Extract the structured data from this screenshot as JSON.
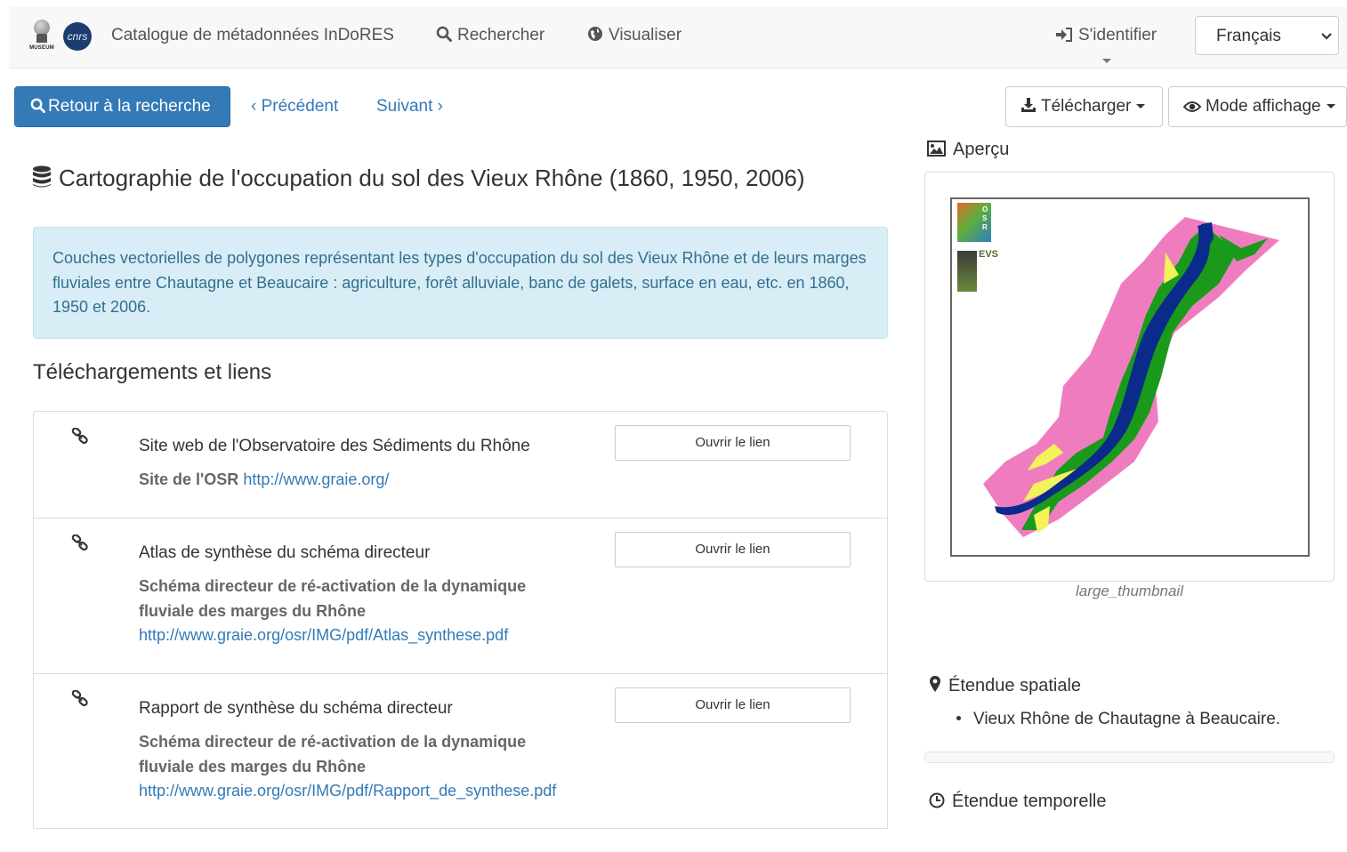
{
  "navbar": {
    "logo_museum_text": "MUSEUM",
    "logo_cnrs_text": "cnrs",
    "brand": "Catalogue de métadonnées InDoRES",
    "search": "Rechercher",
    "visualize": "Visualiser",
    "login": "S'identifier",
    "language": "Français"
  },
  "toolbar": {
    "back": "Retour à la recherche",
    "previous": "‹ Précédent",
    "next": "Suivant ›",
    "download": "Télécharger",
    "display_mode": "Mode affichage"
  },
  "record": {
    "title": "Cartographie de l'occupation du sol des Vieux Rhône (1860, 1950, 2006)",
    "abstract": "Couches vectorielles de polygones représentant les types d'occupation du sol des Vieux Rhône et de leurs marges fluviales entre Chautagne et Beaucaire : agriculture, forêt alluviale, banc de galets, surface en eau, etc. en 1860, 1950 et 2006."
  },
  "links_section": {
    "heading": "Téléchargements et liens",
    "items": [
      {
        "title": "Site web de l'Observatoire des Sédiments du Rhône",
        "desc_bold": "Site de l'OSR",
        "url": "http://www.graie.org/",
        "button": "Ouvrir le lien"
      },
      {
        "title": "Atlas de synthèse du schéma directeur",
        "desc_bold": "Schéma directeur de ré-activation de la dynamique fluviale des marges du Rhône",
        "url": "http://www.graie.org/osr/IMG/pdf/Atlas_synthese.pdf",
        "button": "Ouvrir le lien"
      },
      {
        "title": "Rapport de synthèse du schéma directeur",
        "desc_bold": "Schéma directeur de ré-activation de la dynamique fluviale des marges du Rhône",
        "url": "http://www.graie.org/osr/IMG/pdf/Rapport_de_synthese.pdf",
        "button": "Ouvrir le lien"
      }
    ]
  },
  "sidebar": {
    "preview_heading": "Aperçu",
    "preview_caption": "large_thumbnail",
    "thumb_logo_osr": "OSR",
    "thumb_logo_evs": "EVS",
    "spatial_heading": "Étendue spatiale",
    "spatial_item": "Vieux Rhône de Chautagne à Beaucaire.",
    "temporal_heading": "Étendue temporelle"
  },
  "colors": {
    "primary": "#337ab7",
    "info_bg": "#d9edf7",
    "info_text": "#31708f",
    "map_pink": "#f07cc0",
    "map_green": "#1a9a1a",
    "map_river": "#0a2a8c",
    "map_yellow": "#f2f25a"
  },
  "icons": [
    "search-icon",
    "globe-icon",
    "sign-in-icon",
    "database-icon",
    "download-icon",
    "eye-icon",
    "link-icon",
    "picture-icon",
    "map-marker-icon",
    "clock-icon",
    "chevron-down-icon"
  ]
}
